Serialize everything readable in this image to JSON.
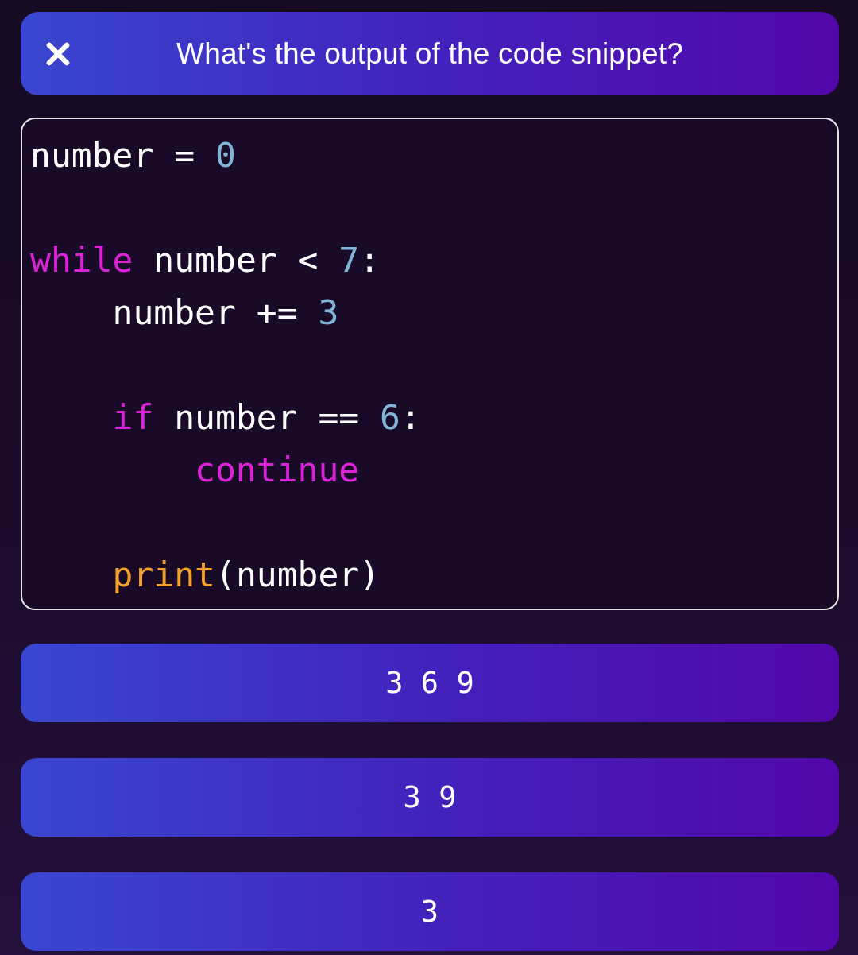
{
  "header": {
    "title": "What's the output of the code snippet?"
  },
  "code": {
    "lines": [
      {
        "kind": "code",
        "tokens": [
          {
            "kind": "plain",
            "text": "number = "
          },
          {
            "kind": "number",
            "text": "0"
          }
        ]
      },
      {
        "kind": "blank"
      },
      {
        "kind": "code",
        "tokens": [
          {
            "kind": "keyword",
            "text": "while"
          },
          {
            "kind": "plain",
            "text": " number < "
          },
          {
            "kind": "number",
            "text": "7"
          },
          {
            "kind": "plain",
            "text": ":"
          }
        ],
        "children": [
          {
            "kind": "code",
            "tokens": [
              {
                "kind": "plain",
                "text": "number += "
              },
              {
                "kind": "number",
                "text": "3"
              }
            ]
          },
          {
            "kind": "blank"
          },
          {
            "kind": "code",
            "tokens": [
              {
                "kind": "keyword",
                "text": "if"
              },
              {
                "kind": "plain",
                "text": " number == "
              },
              {
                "kind": "number",
                "text": "6"
              },
              {
                "kind": "plain",
                "text": ":"
              }
            ],
            "children": [
              {
                "kind": "code",
                "tokens": [
                  {
                    "kind": "keyword",
                    "text": "continue"
                  }
                ]
              }
            ]
          },
          {
            "kind": "blank"
          },
          {
            "kind": "code",
            "tokens": [
              {
                "kind": "builtin",
                "text": "print"
              },
              {
                "kind": "plain",
                "text": "(number)"
              }
            ]
          }
        ]
      }
    ]
  },
  "answers": [
    {
      "text": "3 6 9"
    },
    {
      "text": "3 9"
    },
    {
      "text": "3"
    }
  ]
}
